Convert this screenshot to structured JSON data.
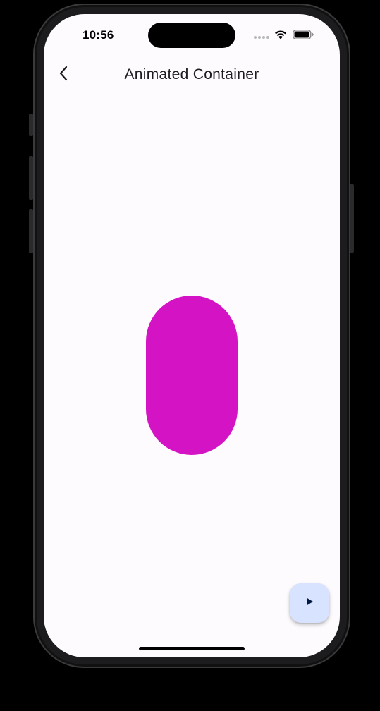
{
  "status_bar": {
    "time": "10:56",
    "icons": [
      "signal-icon",
      "wifi-icon",
      "battery-icon"
    ]
  },
  "app_bar": {
    "title": "Animated Container",
    "back_icon": "chevron-left-icon"
  },
  "animated_container": {
    "color": "#d414c4"
  },
  "fab": {
    "icon": "play-icon",
    "background": "#d7e3ff"
  },
  "colors": {
    "screen_background": "#fdfbfe",
    "title_text": "#1d1b20"
  }
}
